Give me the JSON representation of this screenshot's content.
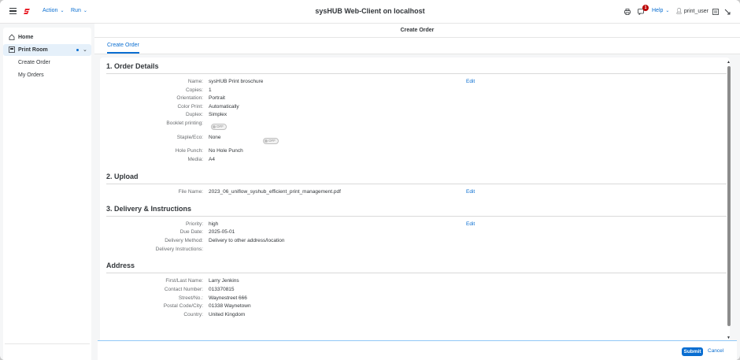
{
  "app": {
    "title": "sysHUB Web-Client on localhost",
    "menu": {
      "action": "Action",
      "run": "Run"
    },
    "notification_count": "1",
    "help": "Help",
    "user": "print_user"
  },
  "sidebar": {
    "items": [
      {
        "label": "Home",
        "icon": "home-icon"
      },
      {
        "label": "Print Room",
        "icon": "printer-room-icon"
      },
      {
        "label": "Create Order"
      },
      {
        "label": "My Orders"
      }
    ]
  },
  "page": {
    "title": "Create Order",
    "tab": "Create Order"
  },
  "sections": {
    "order_details": {
      "title": "1. Order Details",
      "edit": "Edit",
      "name_label": "Name:",
      "name_value": "sysHUB Print broschure",
      "copies_label": "Copies:",
      "copies_value": "1",
      "orientation_label": "Orientation:",
      "orientation_value": "Portrait",
      "color_label": "Color Print:",
      "color_value": "Automatically",
      "duplex_label": "Duplex:",
      "duplex_value": "Simplex",
      "booklet_label": "Booklet printing:",
      "booklet_switch": "OFF",
      "staple_label": "Staple/Eco:",
      "staple_value": "None",
      "staple_switch": "OFF",
      "hole_label": "Hole Punch:",
      "hole_value": "No Hole Punch",
      "media_label": "Media:",
      "media_value": "A4"
    },
    "upload": {
      "title": "2. Upload",
      "edit": "Edit",
      "file_label": "File Name:",
      "file_value": "2023_06_uniflow_syshub_efficient_print_management.pdf"
    },
    "delivery": {
      "title": "3. Delivery & Instructions",
      "edit": "Edit",
      "priority_label": "Priority:",
      "priority_value": "high",
      "due_label": "Due Date:",
      "due_value": "2025-05-01",
      "method_label": "Delivery Method:",
      "method_value": "Delivery to other address/location",
      "instr_label": "Delivery Instructions:",
      "instr_value": ""
    },
    "address": {
      "title": "Address",
      "name_label": "First/Last Name:",
      "name_value": "Larry Jenkins",
      "contact_label": "Contact Number:",
      "contact_value": "013370815",
      "street_label": "Street/No.:",
      "street_value": "Waynestreet 666",
      "postal_label": "Postal Code/City:",
      "postal_value": "01338 Waynetown",
      "country_label": "Country:",
      "country_value": "United Kingdom"
    }
  },
  "footer": {
    "submit": "Submit",
    "cancel": "Cancel"
  },
  "colors": {
    "accent": "#0a6ed1",
    "selected_bg": "#e5f0fa",
    "badge": "#bb0000"
  }
}
